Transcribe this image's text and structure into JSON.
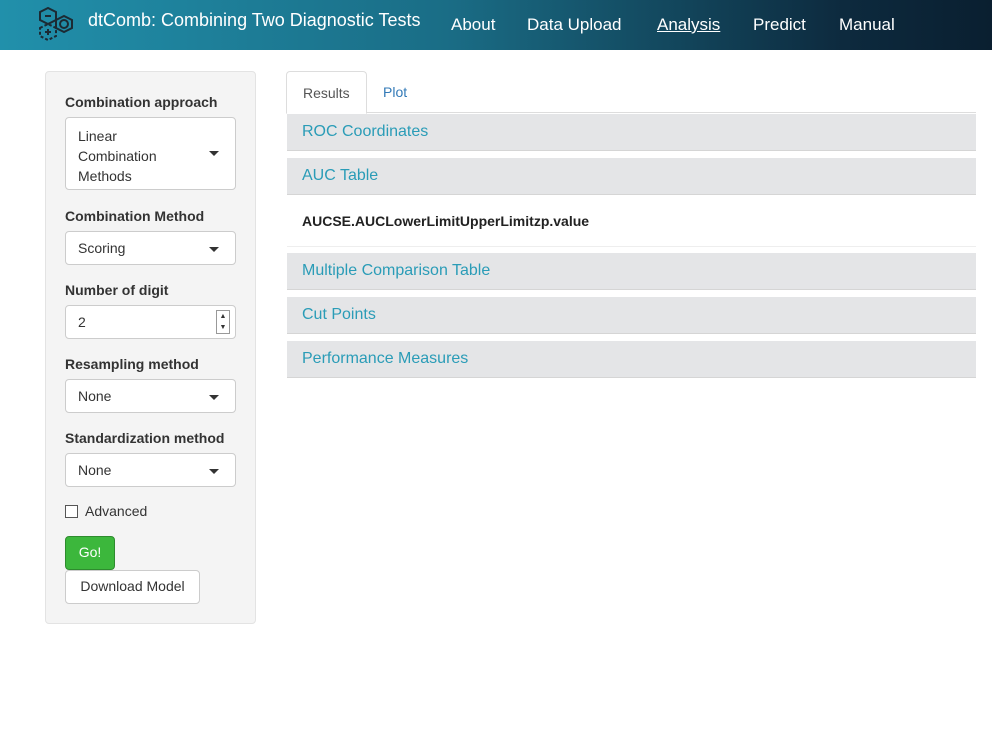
{
  "navbar": {
    "title": "dtComb: Combining Two Diagnostic Tests",
    "items": [
      "About",
      "Data Upload",
      "Analysis",
      "Predict",
      "Manual"
    ],
    "active": "Analysis"
  },
  "sidebar": {
    "combination_approach": {
      "label": "Combination approach",
      "value": "Linear Combination Methods"
    },
    "combination_method": {
      "label": "Combination Method",
      "value": "Scoring"
    },
    "digits": {
      "label": "Number of digit",
      "value": "2"
    },
    "resampling": {
      "label": "Resampling method",
      "value": "None"
    },
    "standardization": {
      "label": "Standardization method",
      "value": "None"
    },
    "advanced": {
      "label": "Advanced",
      "checked": false
    },
    "go_label": "Go!",
    "download_label": "Download Model"
  },
  "tabs": [
    "Results",
    "Plot"
  ],
  "panels": [
    "ROC Coordinates",
    "AUC Table",
    "Multiple Comparison Table",
    "Cut Points",
    "Performance Measures"
  ],
  "auc_table": {
    "columns": [
      "AUC",
      "SE.AUC",
      "LowerLimit",
      "UpperLimit",
      "z",
      "p.value"
    ]
  },
  "colors": {
    "accent": "#2a9cb7",
    "go": "#3cb73c"
  }
}
